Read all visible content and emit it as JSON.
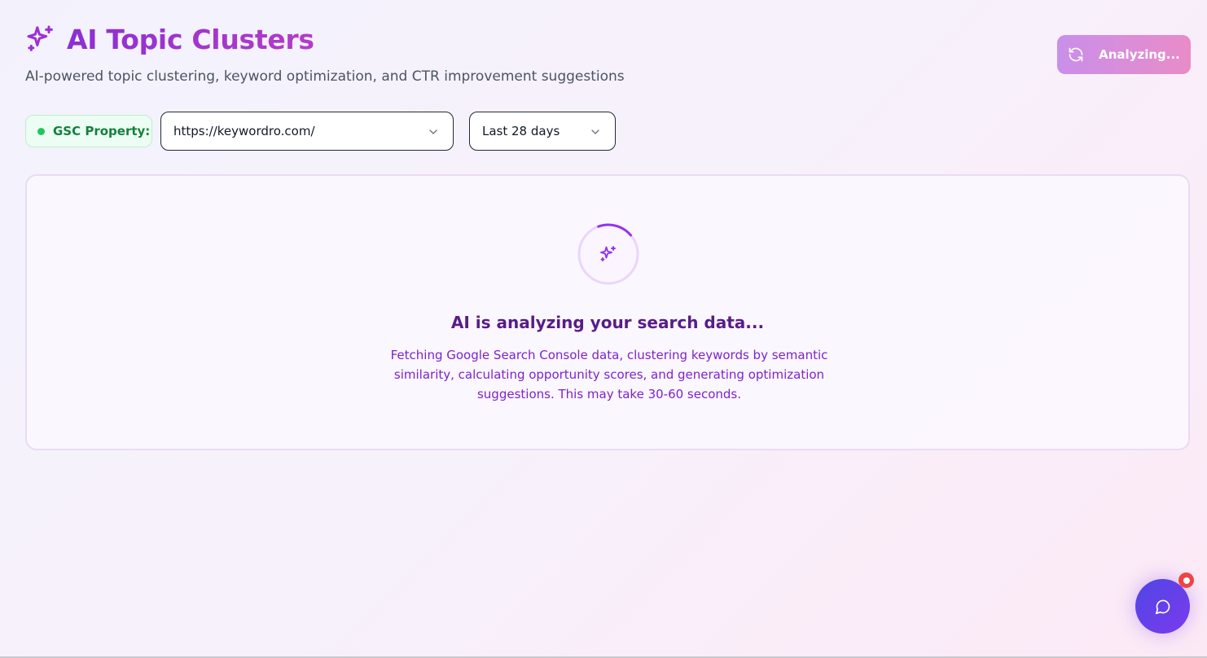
{
  "header": {
    "title": "AI Topic Clusters",
    "subtitle": "AI-powered topic clustering, keyword optimization, and CTR improvement suggestions",
    "title_icon": "sparkles-icon"
  },
  "toolbar": {
    "analyze_label": "Analyzing...",
    "analyze_icon": "refresh-icon"
  },
  "controls": {
    "gsc_label": "GSC Property:",
    "property_value": "https://keywordro.com/",
    "range_value": "Last 28 days"
  },
  "loading": {
    "heading": "AI is analyzing your search data...",
    "description": "Fetching Google Search Console data, clustering keywords by semantic similarity, calculating opportunity scores, and generating optimization suggestions. This may take 30-60 seconds.",
    "icon": "sparkles-icon"
  },
  "chat": {
    "icon": "chat-bubble-icon"
  },
  "colors": {
    "accent": "#9333ea",
    "success": "#22c55e",
    "notification": "#ef4444"
  }
}
